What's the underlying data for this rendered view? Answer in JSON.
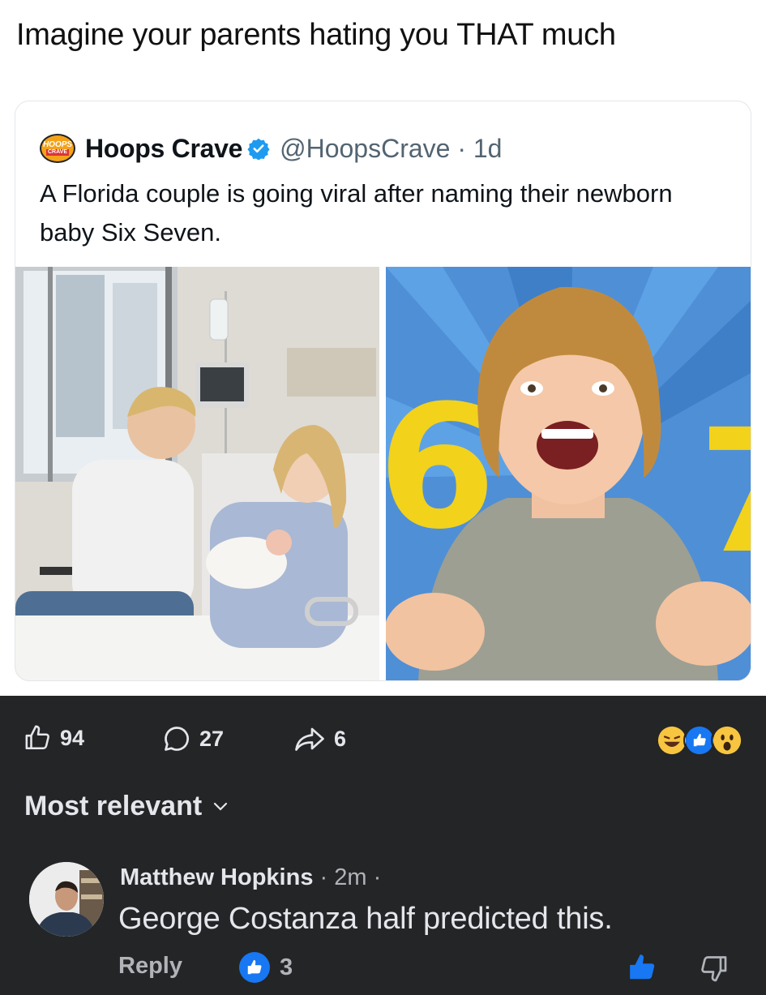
{
  "caption": "Imagine your parents hating you THAT much",
  "tweet": {
    "avatar_text_top": "HOOPS",
    "avatar_text_bottom": "CRAVE",
    "display_name": "Hoops Crave",
    "handle_time": "@HoopsCrave · 1d",
    "text": "A Florida couple is going viral after naming their newborn baby Six Seven.",
    "image_right_numerals": [
      "6",
      "7"
    ]
  },
  "stats": {
    "likes": "94",
    "comments": "27",
    "shares": "6"
  },
  "reactions": [
    "laugh",
    "like",
    "wow"
  ],
  "sort": {
    "label": "Most relevant"
  },
  "comment": {
    "author": "Matthew Hopkins",
    "time": " · 2m ·",
    "text": "George Costanza half predicted this.",
    "reply_label": "Reply",
    "like_count": "3"
  },
  "colors": {
    "fb_background": "#242526",
    "fb_text": "#e4e6eb",
    "fb_secondary": "#b0b3b8",
    "fb_blue": "#1877f2",
    "verified": "#1d9bf0"
  }
}
